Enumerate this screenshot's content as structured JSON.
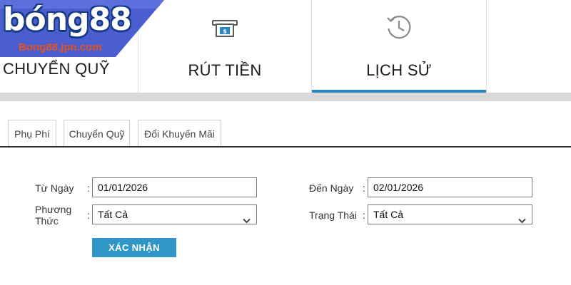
{
  "logo": {
    "brand": "bóng88",
    "url_text": "Bong88.jpn.com",
    "colors": {
      "panel": "#4a5ed0",
      "text_outline": "#173a86",
      "url": "#e2541e"
    }
  },
  "nav": {
    "tabs": [
      {
        "label": "CHUYỂN QUỸ",
        "icon": null,
        "active": false
      },
      {
        "label": "RÚT TIỀN",
        "icon": "cash-register-icon",
        "active": false
      },
      {
        "label": "LỊCH SỬ",
        "icon": "history-clock-icon",
        "active": true
      }
    ],
    "active_color": "#2a86b8"
  },
  "subtabs": [
    "Phụ Phí",
    "Chuyển Quỹ",
    "Đổi Khuyến Mãi"
  ],
  "form": {
    "from_date": {
      "label": "Từ Ngày",
      "value": "01/01/2026"
    },
    "to_date": {
      "label": "Đến Ngày",
      "value": "02/01/2026"
    },
    "method": {
      "label_line1": "Phương",
      "label_line2": "Thức",
      "value": "Tất Cả"
    },
    "status": {
      "label": "Trạng Thái",
      "value": "Tất Cả"
    },
    "colon": ":",
    "submit_label": "XÁC NHẬN",
    "submit_color": "#2f96c7"
  }
}
